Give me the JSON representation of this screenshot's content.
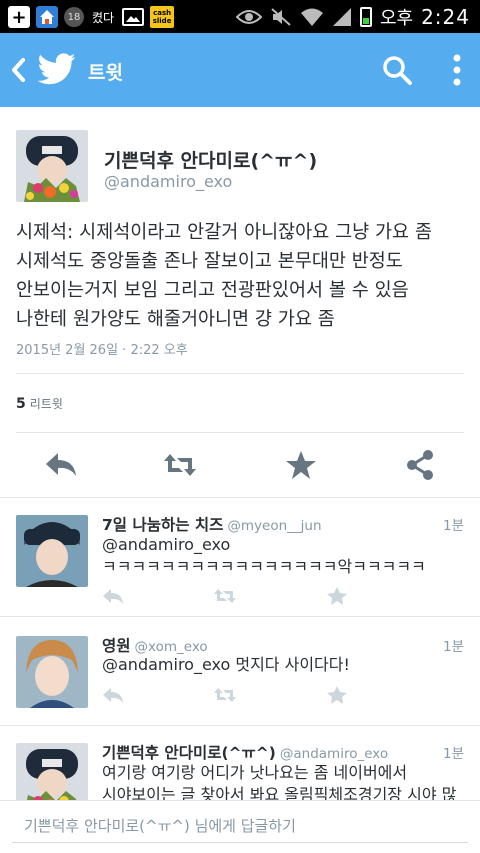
{
  "status_bar": {
    "notification_text": "켰다",
    "cash_label": "cash slide",
    "badge_num": "18",
    "ampm": "오후",
    "time": "2:24"
  },
  "app_bar": {
    "title": "트윗"
  },
  "tweet": {
    "author_name": "기쁜덕후 안다미로(^ㅠ^)",
    "author_handle": "@andamiro_exo",
    "text_lines": [
      "시제석: 시제석이라고 안갈거 아니잖아요 그냥 가요 좀",
      "시제석도 중앙돌출 존나 잘보이고 본무대만 반정도",
      "안보이는거지 보임 그리고 전광판있어서 볼 수 있음",
      "나한테 원가양도 해줄거아니면 걍 가요 좀"
    ],
    "timestamp": "2015년 2월 26일 · 2:22 오후",
    "retweet_count": "5",
    "retweet_label": "리트윗"
  },
  "replies": [
    {
      "name": "7일 나눔하는 치즈",
      "handle": "@myeon__jun",
      "time": "1분",
      "lines": [
        "@andamiro_exo",
        "ㅋㅋㅋㅋㅋㅋㅋㅋㅋㅋㅋㅋㅋㅋㅋㅋ악ㅋㅋㅋㅋㅋ"
      ]
    },
    {
      "name": "영원",
      "handle": "@xom_exo",
      "time": "1분",
      "lines": [
        "@andamiro_exo 멋지다 사이다다!"
      ]
    },
    {
      "name": "기쁜덕후 안다미로(^ㅠ^)",
      "handle": "@andamiro_exo",
      "time": "1분",
      "lines": [
        "여기랑 여기랑 어디가 낫나요는 좀 네이버에서",
        "시야보이는 글 찾아서 봐요 올림픽체조경기장 시야 많"
      ]
    }
  ],
  "composer": {
    "placeholder": "기쁜덕후 안다미로(^ㅠ^) 님에게 답글하기"
  },
  "colors": {
    "brand": "#55acee",
    "action_icon": "#66757f",
    "mini_icon": "#ccd6dd",
    "secondary_text": "#8899a6"
  }
}
